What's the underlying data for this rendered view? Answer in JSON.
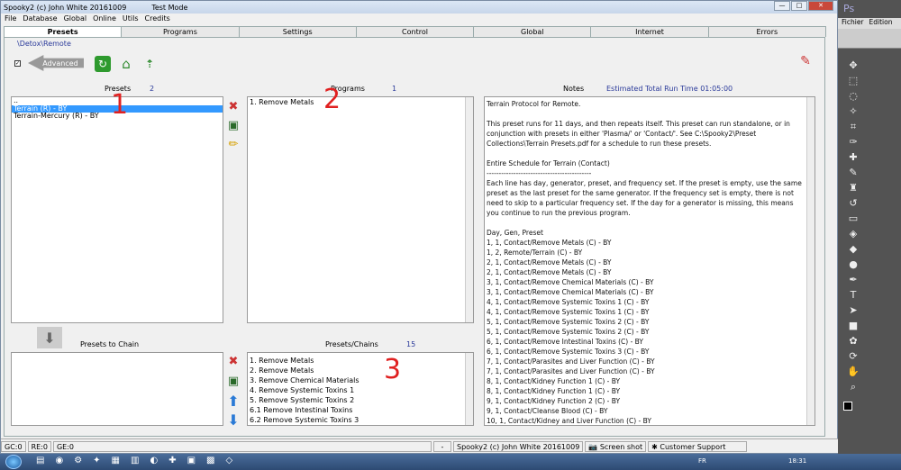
{
  "window": {
    "title": "Spooky2 (c) John White 20161009",
    "mode": "Test Mode"
  },
  "menu": [
    "File",
    "Database",
    "Global",
    "Online",
    "Utils",
    "Credits"
  ],
  "tabs": [
    "Presets",
    "Programs",
    "Settings",
    "Control",
    "Global",
    "Internet",
    "Errors"
  ],
  "path": "\\Detox\\Remote",
  "advanced": "Advanced",
  "presets": {
    "label": "Presets",
    "count": "2",
    "items": [
      "..",
      "Terrain (R) - BY",
      "Terrain-Mercury (R) - BY"
    ]
  },
  "programs": {
    "label": "Programs",
    "count": "1",
    "items": [
      "1. Remove Metals"
    ]
  },
  "notes": {
    "label": "Notes",
    "runtime": "Estimated Total Run Time 01:05:00",
    "text": "Terrain Protocol for Remote.\n\nThis preset runs for 11 days, and then repeats itself. This preset can run standalone, or in conjunction with presets in either 'Plasma/' or 'Contact/'. See C:\\Spooky2\\Preset Collections\\Terrain Presets.pdf for a schedule to run these presets.\n\nEntire Schedule for Terrain (Contact)\n-------------------------------------------\nEach line has day, generator, preset, and frequency set. If the preset is empty, use the same preset as the last preset for the same generator. If the frequency set is empty, there is not need to skip to a particular frequency set. If the day for a generator is missing, this means you continue to run the previous program.\n\nDay, Gen, Preset\n1, 1, Contact/Remove Metals (C) - BY\n1, 2, Remote/Terrain (C) - BY\n2, 1, Contact/Remove Metals (C) - BY\n2, 1, Contact/Remove Metals (C) - BY\n3, 1, Contact/Remove Chemical Materials (C) - BY\n3, 1, Contact/Remove Chemical Materials (C) - BY\n4, 1, Contact/Remove Systemic Toxins 1 (C) - BY\n4, 1, Contact/Remove Systemic Toxins 1 (C) - BY\n5, 1, Contact/Remove Systemic Toxins 2 (C) - BY\n5, 1, Contact/Remove Systemic Toxins 2 (C) - BY\n6, 1, Contact/Remove Intestinal Toxins (C) - BY\n6, 1, Contact/Remove Systemic Toxins 3 (C) - BY\n7, 1, Contact/Parasites and Liver Function (C) - BY\n7, 1, Contact/Parasites and Liver Function (C) - BY\n8, 1, Contact/Kidney Function 1 (C) - BY\n8, 1, Contact/Kidney Function 1 (C) - BY\n9, 1, Contact/Kidney Function 2 (C) - BY\n9, 1, Contact/Cleanse Blood (C) - BY\n10, 1, Contact/Kidney and Liver Function (C) - BY"
  },
  "chain": {
    "label": "Presets to Chain"
  },
  "presetsChains": {
    "label": "Presets/Chains",
    "count": "15",
    "items": [
      "1. Remove Metals",
      "2. Remove Metals",
      "3. Remove Chemical Materials",
      "4. Remove Systemic Toxins 1",
      "5. Remove Systemic Toxins 2",
      "6.1 Remove Intestinal Toxins",
      "6.2 Remove Systemic Toxins 3"
    ]
  },
  "annot": [
    "1",
    "2",
    "3"
  ],
  "status": {
    "gc": "GC:0",
    "re": "RE:0",
    "ge": "GE:0",
    "dash": "-",
    "app": "Spooky2 (c) John White 20161009",
    "screenshot": "Screen shot",
    "support": "Customer Support"
  },
  "taskbar": {
    "lang": "FR",
    "time": "18:31"
  },
  "ps": {
    "logo": "Ps",
    "menu1": "Fichier",
    "menu2": "Edition"
  }
}
